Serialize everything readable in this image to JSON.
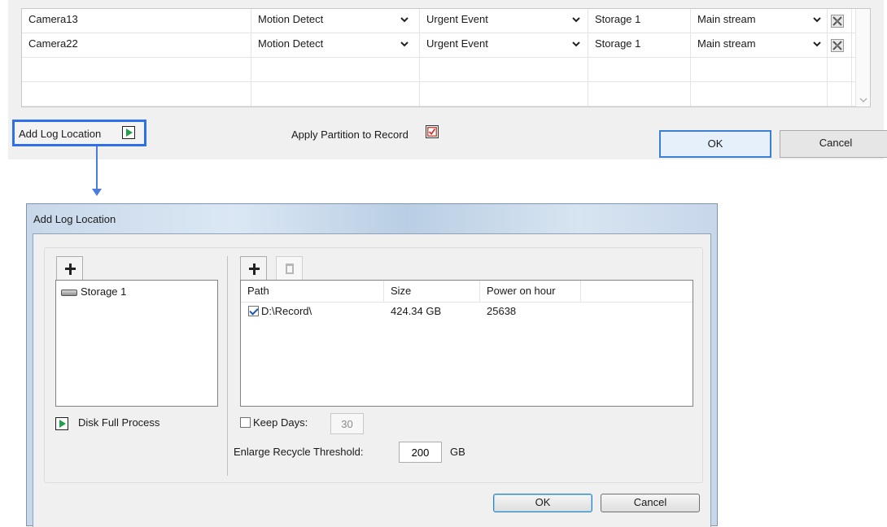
{
  "camera_table": {
    "rows": [
      {
        "camera": "Camera13",
        "trigger": "Motion Detect",
        "event": "Urgent Event",
        "storage": "Storage 1",
        "stream": "Main stream"
      },
      {
        "camera": "Camera22",
        "trigger": "Motion Detect",
        "event": "Urgent Event",
        "storage": "Storage 1",
        "stream": "Main stream"
      }
    ]
  },
  "footer": {
    "add_log_location_label": "Add Log Location",
    "apply_partition_label": "Apply Partition to Record",
    "ok_label": "OK",
    "cancel_label": "Cancel"
  },
  "dialog": {
    "title": "Add Log Location",
    "storage_list": [
      "Storage 1"
    ],
    "disk_full_process_label": "Disk Full Process",
    "path_table": {
      "columns": [
        "Path",
        "Size",
        "Power on hour"
      ],
      "rows": [
        {
          "checked": true,
          "path": "D:\\Record\\",
          "size": "424.34 GB",
          "power_on_hour": "25638"
        }
      ]
    },
    "keep_days_label": "Keep Days:",
    "keep_days_value": "30",
    "enlarge_recycle_label": "Enlarge Recycle Threshold:",
    "enlarge_recycle_value": "200",
    "enlarge_recycle_unit": "GB",
    "ok_label": "OK",
    "cancel_label": "Cancel"
  }
}
